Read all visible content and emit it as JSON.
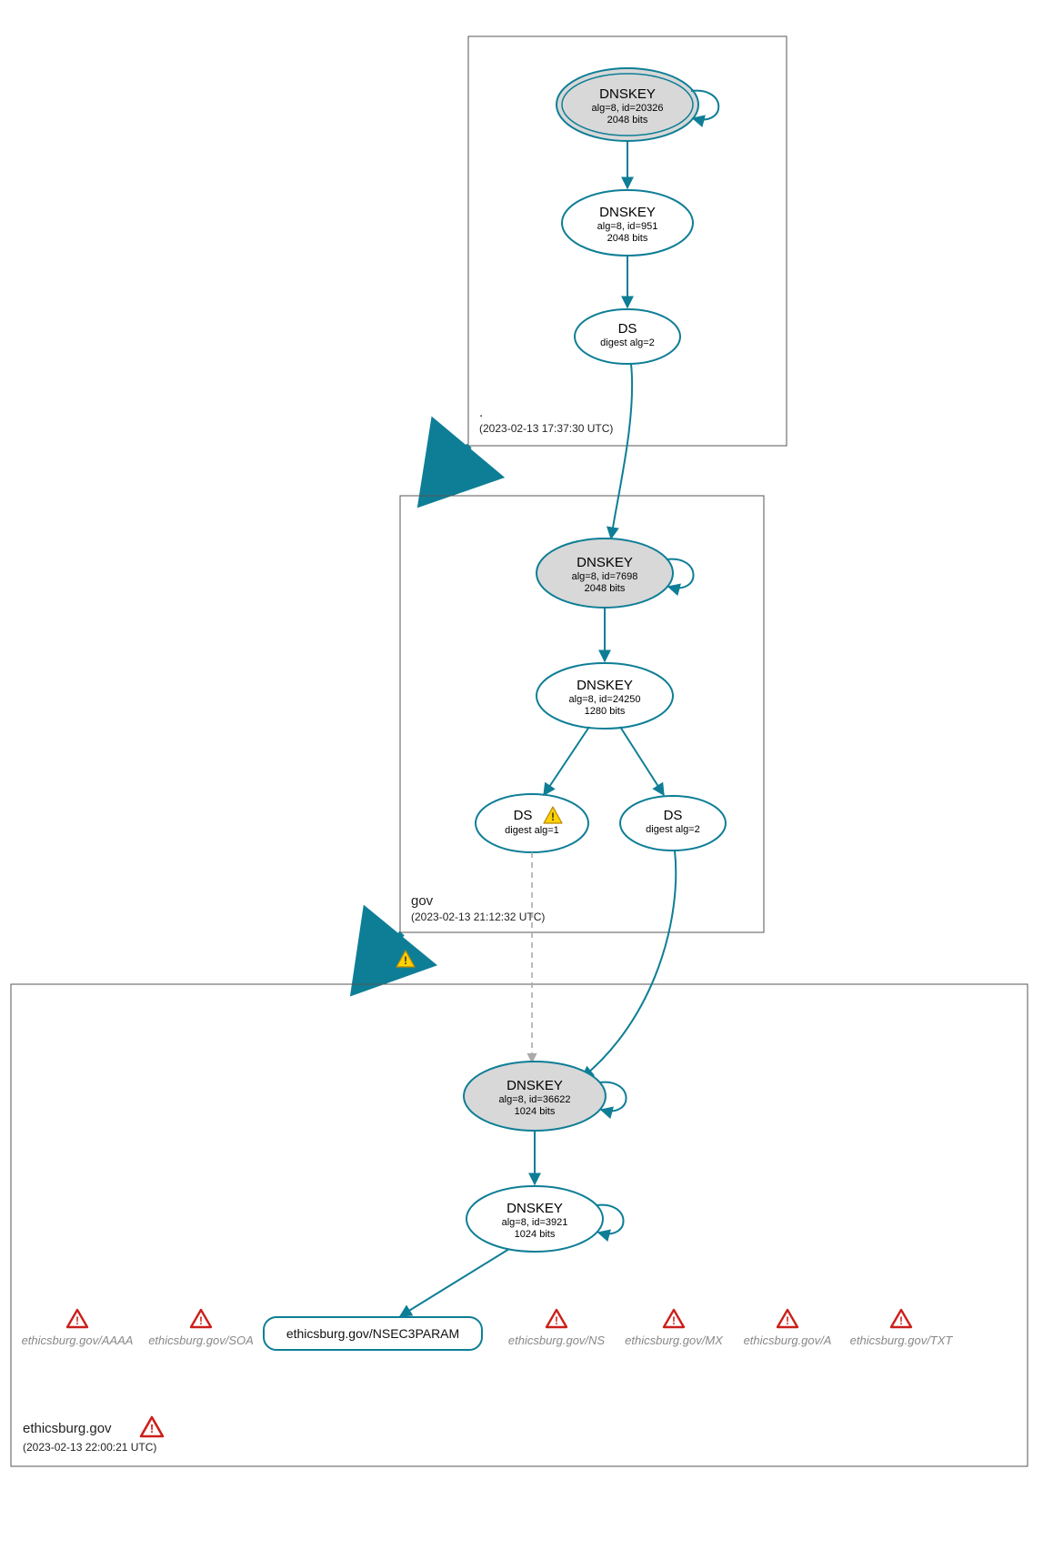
{
  "colors": {
    "teal": "#0e7e96",
    "node_fill_grey": "#d8d8d8",
    "node_fill_white": "#ffffff",
    "box_stroke": "#777777",
    "rr_text": "#888888",
    "warn_fill": "#ffd200",
    "warn_stroke": "#b8860b",
    "err_fill": "#ffffff",
    "err_stroke": "#cc1f1a"
  },
  "zones": {
    "root": {
      "label": ".",
      "timestamp": "(2023-02-13 17:37:30 UTC)",
      "dnskey_ksk": {
        "title": "DNSKEY",
        "line1": "alg=8, id=20326",
        "line2": "2048 bits"
      },
      "dnskey_zsk": {
        "title": "DNSKEY",
        "line1": "alg=8, id=951",
        "line2": "2048 bits"
      },
      "ds": {
        "title": "DS",
        "line1": "digest alg=2"
      }
    },
    "gov": {
      "label": "gov",
      "timestamp": "(2023-02-13 21:12:32 UTC)",
      "dnskey_ksk": {
        "title": "DNSKEY",
        "line1": "alg=8, id=7698",
        "line2": "2048 bits"
      },
      "dnskey_zsk": {
        "title": "DNSKEY",
        "line1": "alg=8, id=24250",
        "line2": "1280 bits"
      },
      "ds1": {
        "title": "DS",
        "line1": "digest alg=1"
      },
      "ds2": {
        "title": "DS",
        "line1": "digest alg=2"
      }
    },
    "ethicsburg": {
      "label": "ethicsburg.gov",
      "timestamp": "(2023-02-13 22:00:21 UTC)",
      "dnskey_ksk": {
        "title": "DNSKEY",
        "line1": "alg=8, id=36622",
        "line2": "1024 bits"
      },
      "dnskey_zsk": {
        "title": "DNSKEY",
        "line1": "alg=8, id=3921",
        "line2": "1024 bits"
      },
      "nsec3param": "ethicsburg.gov/NSEC3PARAM",
      "rr": {
        "aaaa": "ethicsburg.gov/AAAA",
        "soa": "ethicsburg.gov/SOA",
        "ns": "ethicsburg.gov/NS",
        "mx": "ethicsburg.gov/MX",
        "a": "ethicsburg.gov/A",
        "txt": "ethicsburg.gov/TXT"
      }
    }
  }
}
